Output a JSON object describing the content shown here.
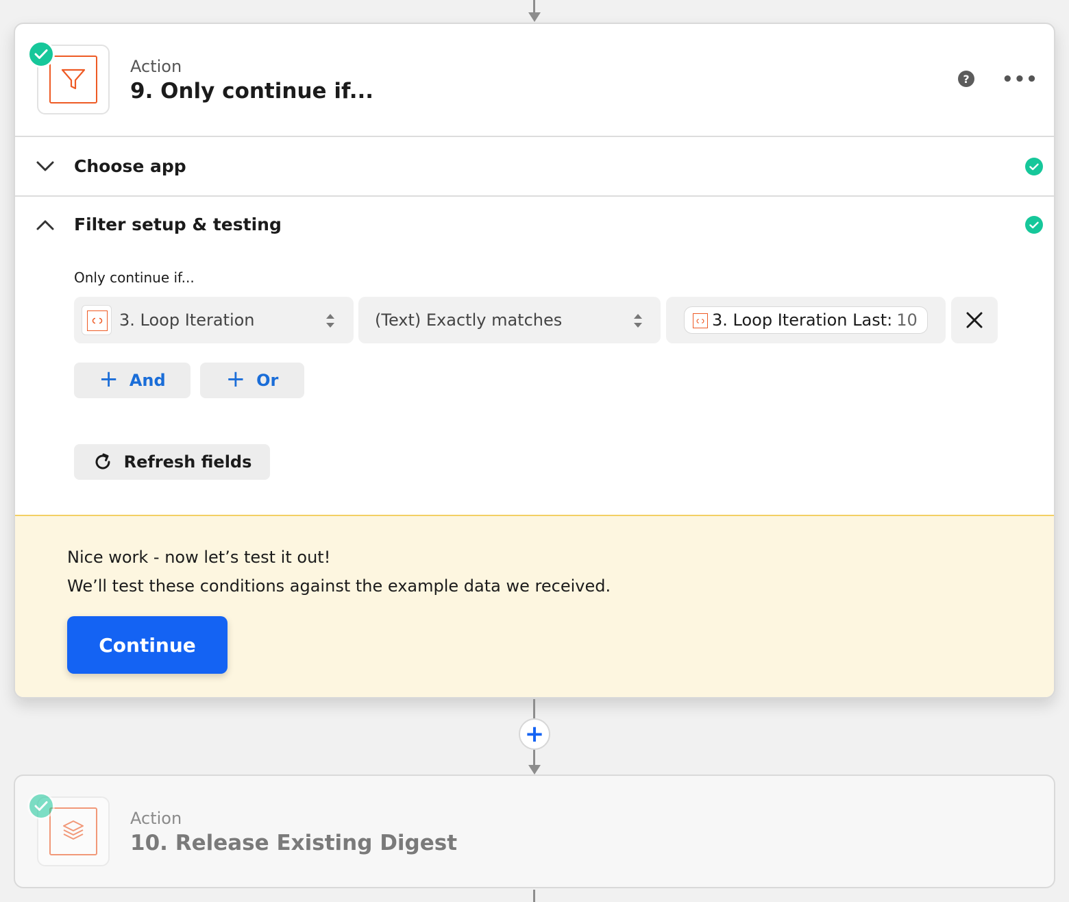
{
  "step9": {
    "type_label": "Action",
    "title": "9. Only continue if...",
    "help": "?",
    "more": "•••"
  },
  "sections": {
    "choose_app": "Choose app",
    "filter_setup": "Filter setup & testing"
  },
  "filter": {
    "label": "Only continue if...",
    "field": "3. Loop Iteration",
    "operator": "(Text) Exactly matches",
    "value_pill_label": "3. Loop Iteration Last:",
    "value_pill_value": "10",
    "and_label": "And",
    "or_label": "Or",
    "plus": "+",
    "refresh_label": "Refresh fields"
  },
  "banner": {
    "line1": "Nice work - now let’s test it out!",
    "line2": "We’ll test these conditions against the example data we received.",
    "continue_label": "Continue"
  },
  "add_step": "+",
  "step10": {
    "type_label": "Action",
    "title": "10. Release Existing Digest"
  },
  "colors": {
    "accent_blue": "#1463f3",
    "success_green": "#16c79a",
    "app_orange": "#ee5a24",
    "banner_bg": "#fdf6e0",
    "banner_border": "#f3cf63"
  }
}
